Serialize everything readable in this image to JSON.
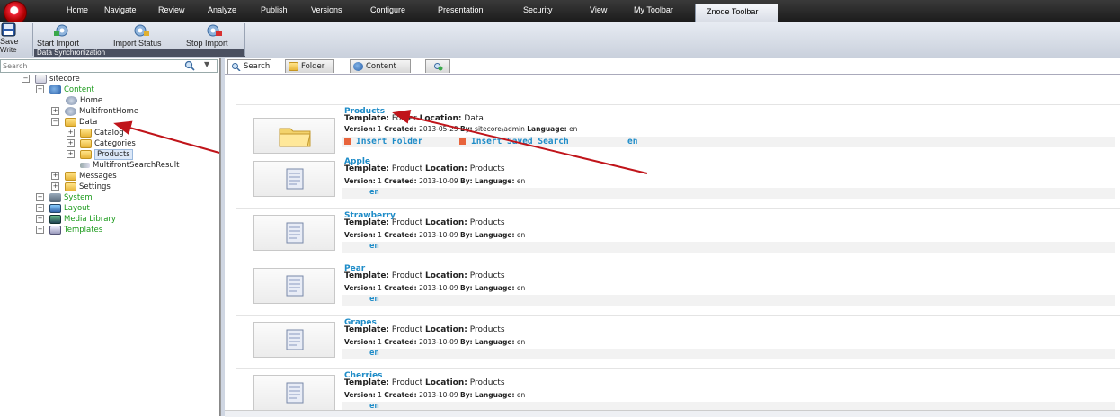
{
  "menubar": {
    "tabs": [
      "Home",
      "Navigate",
      "Review",
      "Analyze",
      "Publish",
      "Versions",
      "Configure",
      "Presentation",
      "Security",
      "View",
      "My Toolbar"
    ],
    "active_tab": "Znode Toolbar"
  },
  "ribbon": {
    "save_label": "Save",
    "write_label": "Write",
    "start_import": "Start Import",
    "import_status": "Import Status",
    "stop_import": "Stop Import",
    "group_caption": "Data Synchronization"
  },
  "tree": {
    "search_placeholder": "Search",
    "nodes": {
      "root": "sitecore",
      "content": "Content",
      "home": "Home",
      "multifront_home": "MultifrontHome",
      "data": "Data",
      "catalog": "Catalog",
      "categories": "Categories",
      "products": "Products",
      "search_result": "MultifrontSearchResult",
      "messages": "Messages",
      "settings": "Settings",
      "system": "System",
      "layout": "Layout",
      "media": "Media Library",
      "templates": "Templates"
    }
  },
  "tabs": {
    "search": "Search",
    "folder": "Folder",
    "content": "Content"
  },
  "results": [
    {
      "title": "Products",
      "template": "Folder",
      "location": "Data",
      "version": "1",
      "created": "2013-05-29",
      "by": "sitecore\\admin",
      "language": "en",
      "actions": [
        "Insert Folder",
        "Insert Saved Search"
      ],
      "lang_link": "en"
    },
    {
      "title": "Apple",
      "template": "Product",
      "location": "Products",
      "version": "1",
      "created": "2013-10-09",
      "by": "",
      "language": "en",
      "lang_link": "en"
    },
    {
      "title": "Strawberry",
      "template": "Product",
      "location": "Products",
      "version": "1",
      "created": "2013-10-09",
      "by": "",
      "language": "en",
      "lang_link": "en"
    },
    {
      "title": "Pear",
      "template": "Product",
      "location": "Products",
      "version": "1",
      "created": "2013-10-09",
      "by": "",
      "language": "en",
      "lang_link": "en"
    },
    {
      "title": "Grapes",
      "template": "Product",
      "location": "Products",
      "version": "1",
      "created": "2013-10-09",
      "by": "",
      "language": "en",
      "lang_link": "en"
    },
    {
      "title": "Cherries",
      "template": "Product",
      "location": "Products",
      "version": "1",
      "created": "2013-10-09",
      "by": "",
      "language": "en",
      "lang_link": "en"
    }
  ],
  "labels": {
    "template": "Template:",
    "location": "Location:",
    "version": "Version:",
    "created": "Created:",
    "by": "By:",
    "language": "Language:"
  },
  "colors": {
    "link": "#1e8cc8",
    "arrow": "#c0141a",
    "tree_green": "#1a9a1a"
  }
}
